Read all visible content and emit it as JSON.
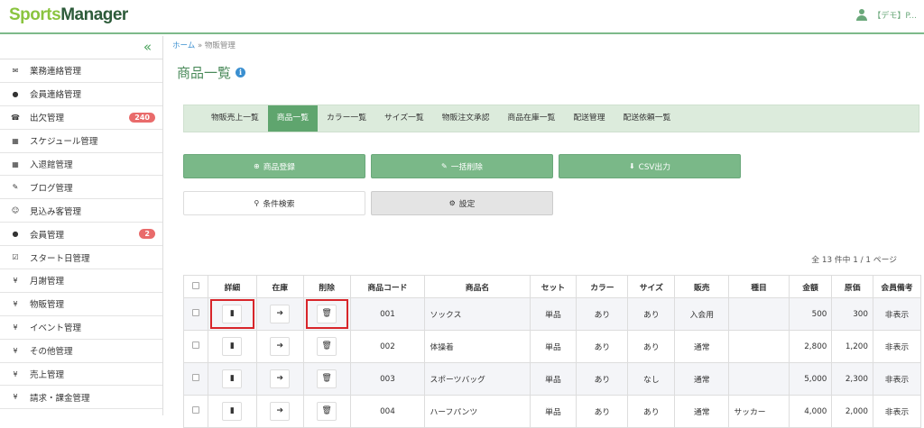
{
  "header": {
    "logo_part1": "Sports",
    "logo_part2": "Manager",
    "user_label": "【デモ】P..."
  },
  "sidebar": {
    "collapse_glyph": "«",
    "items": [
      {
        "label": "業務連絡管理",
        "icon": "envelope-icon",
        "glyph": "✉"
      },
      {
        "label": "会員連絡管理",
        "icon": "comment-icon",
        "glyph": "●"
      },
      {
        "label": "出欠管理",
        "icon": "phone-icon",
        "glyph": "☎",
        "badge": "240"
      },
      {
        "label": "スケジュール管理",
        "icon": "calendar-icon",
        "glyph": "▦"
      },
      {
        "label": "入退館管理",
        "icon": "calendar-icon",
        "glyph": "▦"
      },
      {
        "label": "ブログ管理",
        "icon": "pencil-icon",
        "glyph": "✎"
      },
      {
        "label": "見込み客管理",
        "icon": "smile-icon",
        "glyph": "☺"
      },
      {
        "label": "会員管理",
        "icon": "user-icon",
        "glyph": "●",
        "badge": "2"
      },
      {
        "label": "スタート日管理",
        "icon": "check-square-icon",
        "glyph": "☑"
      },
      {
        "label": "月謝管理",
        "icon": "yen-icon",
        "glyph": "¥"
      },
      {
        "label": "物販管理",
        "icon": "yen-icon",
        "glyph": "¥"
      },
      {
        "label": "イベント管理",
        "icon": "yen-icon",
        "glyph": "¥"
      },
      {
        "label": "その他管理",
        "icon": "yen-icon",
        "glyph": "¥"
      },
      {
        "label": "売上管理",
        "icon": "yen-icon",
        "glyph": "¥"
      },
      {
        "label": "請求・課金管理",
        "icon": "yen-icon",
        "glyph": "¥"
      }
    ]
  },
  "breadcrumb": {
    "home": "ホーム",
    "sep": "»",
    "current": "物販管理"
  },
  "page": {
    "title": "商品一覧"
  },
  "tabs": [
    {
      "label": "物販売上一覧"
    },
    {
      "label": "商品一覧",
      "active": true
    },
    {
      "label": "カラー一覧"
    },
    {
      "label": "サイズ一覧"
    },
    {
      "label": "物販注文承認"
    },
    {
      "label": "商品在庫一覧"
    },
    {
      "label": "配送管理"
    },
    {
      "label": "配送依頼一覧"
    }
  ],
  "actions": {
    "register": "商品登録",
    "bulk_delete": "一括削除",
    "csv": "CSV出力",
    "search": "条件検索",
    "settings": "設定"
  },
  "pagination": {
    "summary": "全 13 件中 1 / 1 ページ"
  },
  "table": {
    "headers": [
      "",
      "詳細",
      "在庫",
      "削除",
      "商品コード",
      "商品名",
      "セット",
      "カラー",
      "サイズ",
      "販売",
      "種目",
      "金額",
      "原価",
      "会員備考"
    ],
    "rows": [
      {
        "code": "001",
        "name": "ソックス",
        "set": "単品",
        "color": "あり",
        "size": "あり",
        "sale": "入会用",
        "category": "",
        "price": "500",
        "cost": "300",
        "note": "非表示"
      },
      {
        "code": "002",
        "name": "体操着",
        "set": "単品",
        "color": "あり",
        "size": "あり",
        "sale": "通常",
        "category": "",
        "price": "2,800",
        "cost": "1,200",
        "note": "非表示"
      },
      {
        "code": "003",
        "name": "スポーツバッグ",
        "set": "単品",
        "color": "あり",
        "size": "なし",
        "sale": "通常",
        "category": "",
        "price": "5,000",
        "cost": "2,300",
        "note": "非表示"
      },
      {
        "code": "004",
        "name": "ハーフパンツ",
        "set": "単品",
        "color": "あり",
        "size": "あり",
        "sale": "通常",
        "category": "サッカー",
        "price": "4,000",
        "cost": "2,000",
        "note": "非表示"
      }
    ]
  },
  "colors": {
    "accent": "#5fa56e",
    "button": "#7ab888",
    "badge": "#e96b6b",
    "highlight": "#d8252a"
  }
}
